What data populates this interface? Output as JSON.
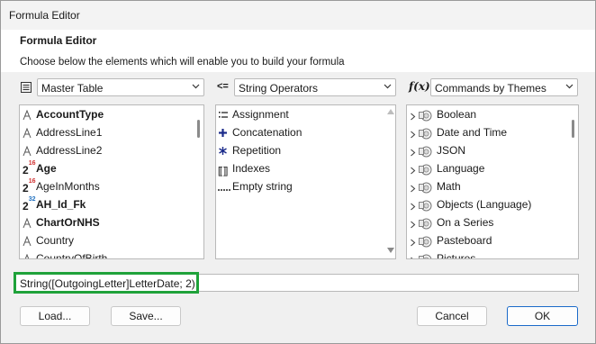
{
  "window": {
    "title": "Formula Editor"
  },
  "header": {
    "title": "Formula Editor",
    "subtitle": "Choose below the elements which will enable you to build your formula"
  },
  "left_dropdown": {
    "value": "Master Table"
  },
  "middle_dropdown": {
    "value": "String Operators"
  },
  "right_dropdown": {
    "label": "f(x)",
    "value": "Commands by Themes"
  },
  "fields": [
    {
      "label": "AccountType",
      "bold": true,
      "icon": "text-type-icon"
    },
    {
      "label": "AddressLine1",
      "bold": false,
      "icon": "text-type-icon"
    },
    {
      "label": "AddressLine2",
      "bold": false,
      "icon": "text-type-icon"
    },
    {
      "label": "Age",
      "bold": true,
      "icon": "integer16-icon",
      "badge": "16"
    },
    {
      "label": "AgeInMonths",
      "bold": false,
      "icon": "integer16-icon",
      "badge": "16"
    },
    {
      "label": "AH_Id_Fk",
      "bold": true,
      "icon": "integer32-icon",
      "badge": "32"
    },
    {
      "label": "ChartOrNHS",
      "bold": true,
      "icon": "text-type-icon"
    },
    {
      "label": "Country",
      "bold": false,
      "icon": "text-type-icon"
    },
    {
      "label": "CountryOfBirth",
      "bold": false,
      "icon": "text-type-icon"
    }
  ],
  "operators": [
    {
      "label": "Assignment",
      "icon": "assignment-icon"
    },
    {
      "label": "Concatenation",
      "icon": "plus-icon"
    },
    {
      "label": "Repetition",
      "icon": "asterisk-icon"
    },
    {
      "label": "Indexes",
      "icon": "brackets-icon"
    },
    {
      "label": "Empty string",
      "icon": "dotted-line-icon"
    }
  ],
  "themes": [
    {
      "label": "Boolean"
    },
    {
      "label": "Date and Time"
    },
    {
      "label": "JSON"
    },
    {
      "label": "Language"
    },
    {
      "label": "Math"
    },
    {
      "label": "Objects (Language)"
    },
    {
      "label": "On a Series"
    },
    {
      "label": "Pasteboard"
    },
    {
      "label": "Pictures"
    }
  ],
  "formula": {
    "value": "String([OutgoingLetter]LetterDate; 2)"
  },
  "buttons": {
    "load": "Load...",
    "save": "Save...",
    "cancel": "Cancel",
    "ok": "OK"
  },
  "colors": {
    "highlight": "#1fa23a",
    "primary_border": "#1b6ac9",
    "badge_red": "#d03030",
    "badge_blue": "#2070c0"
  }
}
